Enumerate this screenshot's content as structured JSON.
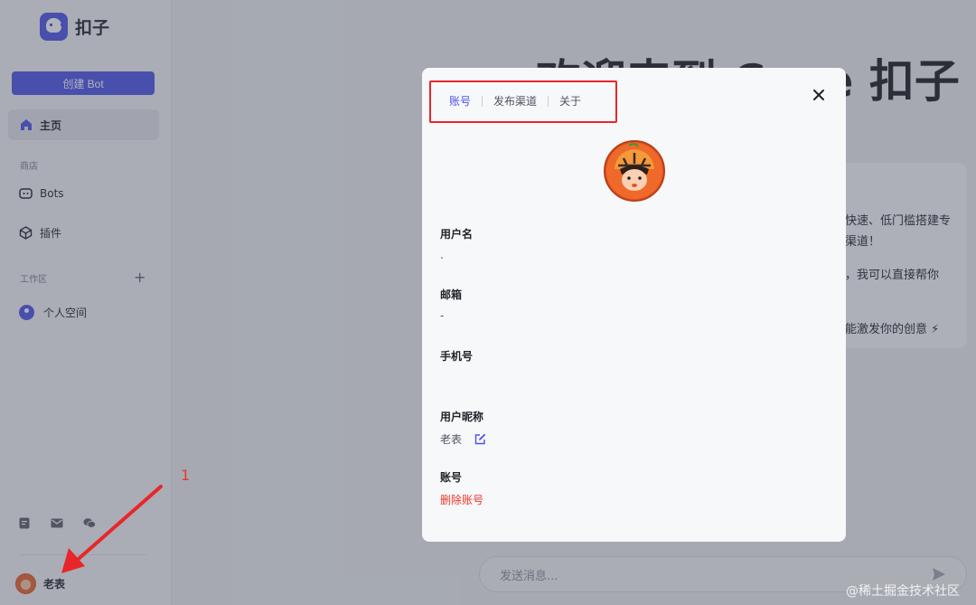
{
  "app": {
    "name": "扣子"
  },
  "sidebar": {
    "create_bot_label": "创建 Bot",
    "home_label": "主页",
    "store_section": "商店",
    "bots_label": "Bots",
    "plugins_label": "插件",
    "workspace_section": "工作区",
    "personal_space_label": "个人空间",
    "user_name": "老表"
  },
  "main": {
    "welcome_title": "欢迎来到 Coze 扣子",
    "card_lines": [
      "快速、低门槛搭建专",
      "渠道！",
      "，我可以直接帮你",
      "能激发你的创意 ⚡"
    ],
    "chat_placeholder": "发送消息..."
  },
  "modal": {
    "tabs": [
      "账号",
      "发布渠道",
      "关于"
    ],
    "active_tab": "账号",
    "fields": {
      "username_label": "用户名",
      "username_value": ".",
      "email_label": "邮箱",
      "email_value": "-",
      "phone_label": "手机号",
      "nickname_label": "用户昵称",
      "nickname_value": "老表",
      "account_label": "账号",
      "delete_account": "删除账号"
    }
  },
  "annotation": {
    "number": "1"
  },
  "watermark": "@稀土掘金技术社区",
  "colors": {
    "accent": "#4d53e8",
    "danger": "#f0352b",
    "annotation": "#e8262a"
  }
}
